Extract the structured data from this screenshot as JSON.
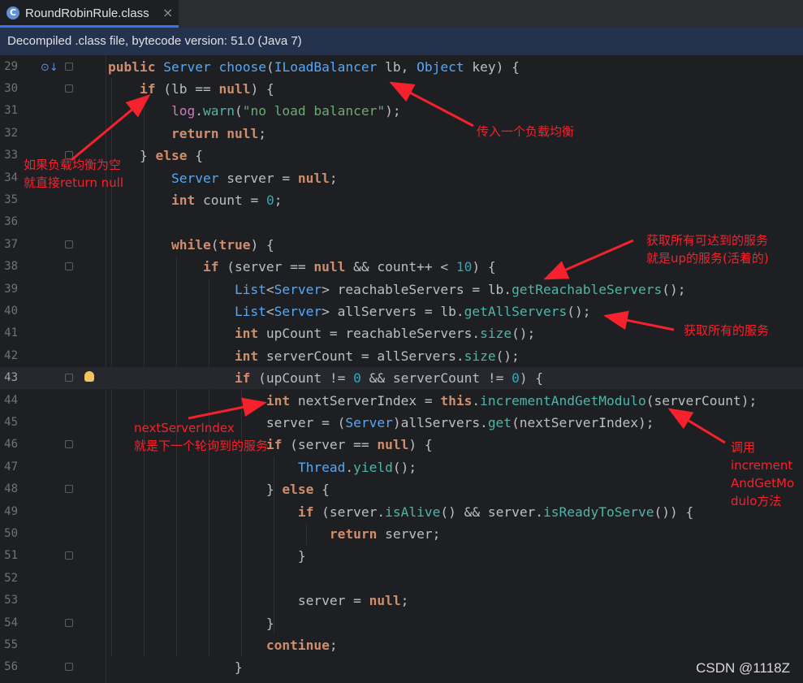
{
  "tab": {
    "title": "RoundRobinRule.class",
    "icon": "class-file-icon",
    "close": "×"
  },
  "banner": {
    "text": "Decompiled .class file, bytecode version: 51.0 (Java 7)"
  },
  "editor": {
    "current_line": 43,
    "lines": [
      {
        "n": "29",
        "code": "<span class=\"kw\">public</span> <span class=\"cls\">Server</span> <span class=\"mth\">choose</span>(<span class=\"cls\">ILoadBalancer</span> lb, <span class=\"cls\">Object</span> key) {"
      },
      {
        "n": "30",
        "code": "    <span class=\"kw\">if</span> (lb == <span class=\"kw\">null</span>) {"
      },
      {
        "n": "31",
        "code": "        <span class=\"fld\">log</span>.<span class=\"inst\">warn</span>(<span class=\"str\">\"no load balancer\"</span>);"
      },
      {
        "n": "32",
        "code": "        <span class=\"kw\">return</span> <span class=\"kw\">null</span>;"
      },
      {
        "n": "33",
        "code": "    } <span class=\"kw\">else</span> {"
      },
      {
        "n": "34",
        "code": "        <span class=\"cls\">Server</span> server = <span class=\"kw\">null</span>;"
      },
      {
        "n": "35",
        "code": "        <span class=\"kw\">int</span> count = <span class=\"num\">0</span>;"
      },
      {
        "n": "36",
        "code": ""
      },
      {
        "n": "37",
        "code": "        <span class=\"kw\">while</span>(<span class=\"kw\">true</span>) {"
      },
      {
        "n": "38",
        "code": "            <span class=\"kw\">if</span> (server == <span class=\"kw\">null</span> &amp;&amp; count++ &lt; <span class=\"num\">10</span>) {"
      },
      {
        "n": "39",
        "code": "                <span class=\"cls\">List</span>&lt;<span class=\"cls\">Server</span>&gt; reachableServers = lb.<span class=\"inst\">getReachableServers</span>();"
      },
      {
        "n": "40",
        "code": "                <span class=\"cls\">List</span>&lt;<span class=\"cls\">Server</span>&gt; allServers = lb.<span class=\"inst\">getAllServers</span>();"
      },
      {
        "n": "41",
        "code": "                <span class=\"kw\">int</span> upCount = reachableServers.<span class=\"inst\">size</span>();"
      },
      {
        "n": "42",
        "code": "                <span class=\"kw\">int</span> serverCount = allServers.<span class=\"inst\">size</span>();"
      },
      {
        "n": "43",
        "code": "                <span class=\"kw\">if</span> (upCount != <span class=\"num\">0</span> &amp;&amp; serverCount != <span class=\"num\">0</span>) {"
      },
      {
        "n": "44",
        "code": "                    <span class=\"kw\">int</span> nextServerIndex = <span class=\"kw\">this</span>.<span class=\"inst\">incrementAndGetModulo</span>(serverCount);"
      },
      {
        "n": "45",
        "code": "                    server = (<span class=\"cls\">Server</span>)allServers.<span class=\"inst\">get</span>(nextServerIndex);"
      },
      {
        "n": "46",
        "code": "                    <span class=\"kw\">if</span> (server == <span class=\"kw\">null</span>) {"
      },
      {
        "n": "47",
        "code": "                        <span class=\"cls\">Thread</span>.<span class=\"inst\">yield</span>();"
      },
      {
        "n": "48",
        "code": "                    } <span class=\"kw\">else</span> {"
      },
      {
        "n": "49",
        "code": "                        <span class=\"kw\">if</span> (server.<span class=\"inst\">isAlive</span>() &amp;&amp; server.<span class=\"inst\">isReadyToServe</span>()) {"
      },
      {
        "n": "50",
        "code": "                            <span class=\"kw\">return</span> server;"
      },
      {
        "n": "51",
        "code": "                        }"
      },
      {
        "n": "52",
        "code": ""
      },
      {
        "n": "53",
        "code": "                        server = <span class=\"kw\">null</span>;"
      },
      {
        "n": "54",
        "code": "                    }"
      },
      {
        "n": "55",
        "code": "                    <span class=\"kw\">continue</span>;"
      },
      {
        "n": "56",
        "code": "                }"
      }
    ]
  },
  "annotations": {
    "null_check": [
      "如果负载均衡为空",
      "就直接return null"
    ],
    "param": [
      "传入一个负载均衡"
    ],
    "reachable": [
      "获取所有可达到的服务",
      "就是up的服务(活着的)"
    ],
    "all": [
      "获取所有的服务"
    ],
    "next_index": [
      "nextServerIndex",
      "就是下一个轮询到的服务"
    ],
    "call": [
      "调用",
      "increment",
      "AndGetMo",
      "dulo方法"
    ]
  },
  "watermark": "CSDN @1118Z",
  "colors": {
    "annotation": "#f5222d",
    "keyword": "#cf8e6d",
    "type": "#56a8f5",
    "string": "#6aab73"
  }
}
